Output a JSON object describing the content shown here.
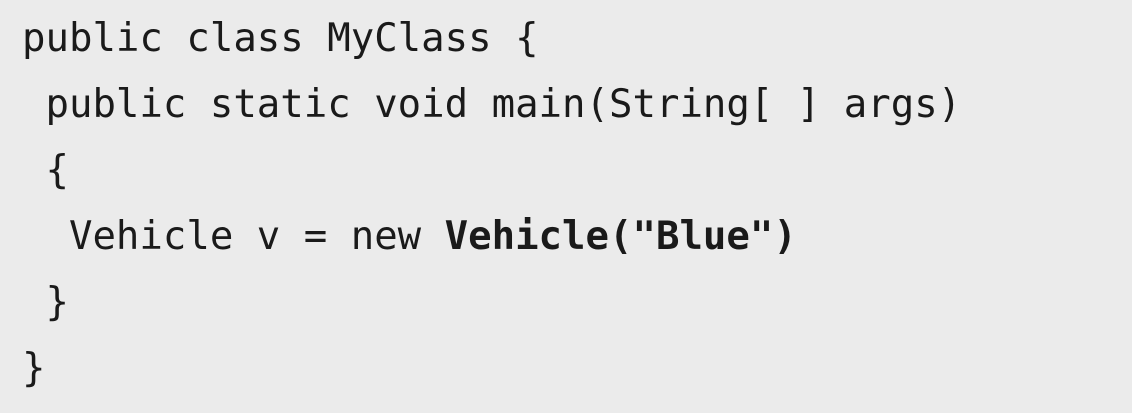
{
  "code": {
    "lines": [
      {
        "text": "public class MyClass {"
      },
      {
        "text": " public static void main(String[ ] args)"
      },
      {
        "text": " {"
      },
      {
        "text": "  Vehicle v = new ",
        "bold": "Vehicle(\"Blue\")"
      },
      {
        "text": " }"
      },
      {
        "text": "}"
      }
    ]
  }
}
